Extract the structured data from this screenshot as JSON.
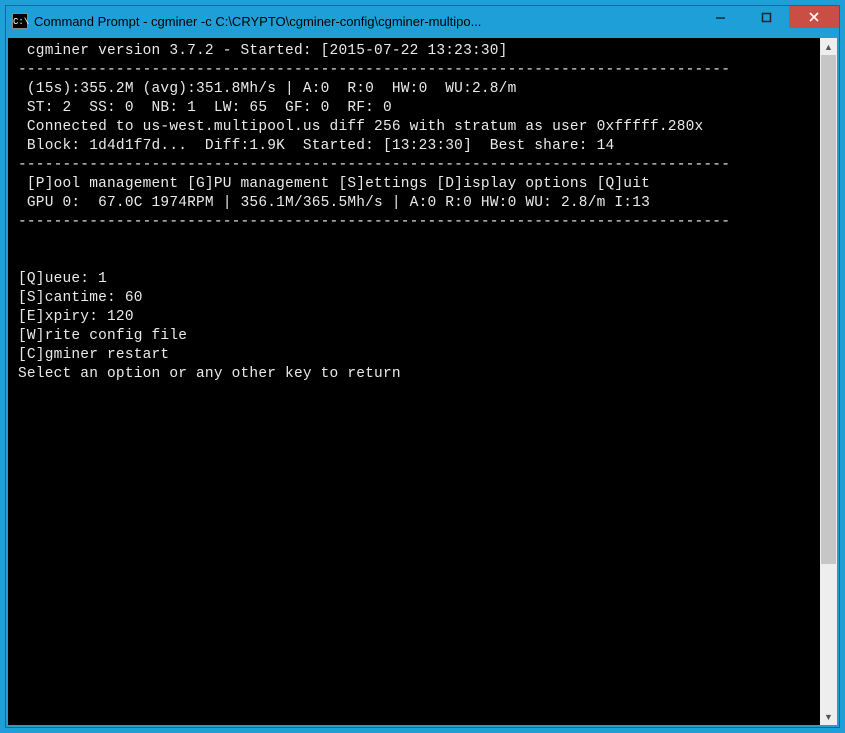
{
  "window": {
    "title": "Command Prompt - cgminer  -c C:\\CRYPTO\\cgminer-config\\cgminer-multipo...",
    "app_icon_label": "C:\\"
  },
  "header": {
    "line": " cgminer version 3.7.2 - Started: [2015-07-22 13:23:30]",
    "version": "3.7.2",
    "started": "2015-07-22 13:23:30"
  },
  "divider": "--------------------------------------------------------------------------------",
  "status": {
    "l1": " (15s):355.2M (avg):351.8Mh/s | A:0  R:0  HW:0  WU:2.8/m",
    "l2": " ST: 2  SS: 0  NB: 1  LW: 65  GF: 0  RF: 0",
    "l3": " Connected to us-west.multipool.us diff 256 with stratum as user 0xfffff.280x",
    "l4": " Block: 1d4d1f7d...  Diff:1.9K  Started: [13:23:30]  Best share: 14",
    "hash_15s": "355.2M",
    "hash_avg": "351.8Mh/s",
    "A": 0,
    "R": 0,
    "HW": 0,
    "WU": "2.8/m",
    "ST": 2,
    "SS": 0,
    "NB": 1,
    "LW": 65,
    "GF": 0,
    "RF": 0,
    "pool_host": "us-west.multipool.us",
    "pool_diff": 256,
    "pool_user": "0xfffff.280x",
    "block": "1d4d1f7d...",
    "diff": "1.9K",
    "block_started": "13:23:30",
    "best_share": 14
  },
  "menu": {
    "l1": " [P]ool management [G]PU management [S]ettings [D]isplay options [Q]uit",
    "l2": " GPU 0:  67.0C 1974RPM | 356.1M/365.5Mh/s | A:0 R:0 HW:0 WU: 2.8/m I:13",
    "gpu0": {
      "temp_c": 67.0,
      "rpm": 1974,
      "rate_cur": "356.1M",
      "rate_avg": "365.5Mh/s",
      "A": 0,
      "R": 0,
      "HW": 0,
      "WU": "2.8/m",
      "I": 13
    }
  },
  "settings": {
    "queue": "[Q]ueue: 1",
    "scantime": "[S]cantime: 60",
    "expiry": "[E]xpiry: 120",
    "write": "[W]rite config file",
    "restart": "[C]gminer restart",
    "prompt": "Select an option or any other key to return",
    "values": {
      "queue": 1,
      "scantime": 60,
      "expiry": 120
    }
  }
}
